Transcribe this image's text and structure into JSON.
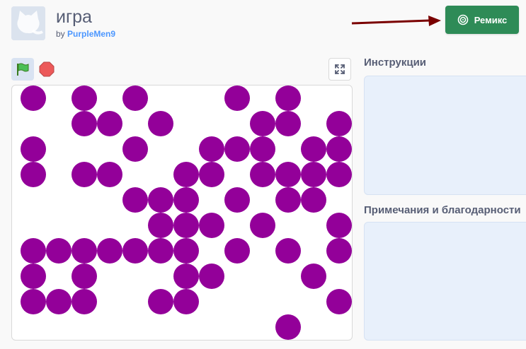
{
  "project": {
    "title": "игра",
    "by_label": "by",
    "author": "PurpleMen9"
  },
  "toolbar": {
    "remix_label": "Ремикс",
    "remix_icon": "remix-spiral-icon",
    "accent_color": "#2e8b57"
  },
  "player": {
    "green_flag_icon": "green-flag-icon",
    "stop_icon": "stop-sign-icon",
    "fullscreen_icon": "fullscreen-icon",
    "dot_color": "#930099"
  },
  "sidebar": {
    "instructions_label": "Инструкции",
    "notes_label": "Примечания и благодарности"
  }
}
